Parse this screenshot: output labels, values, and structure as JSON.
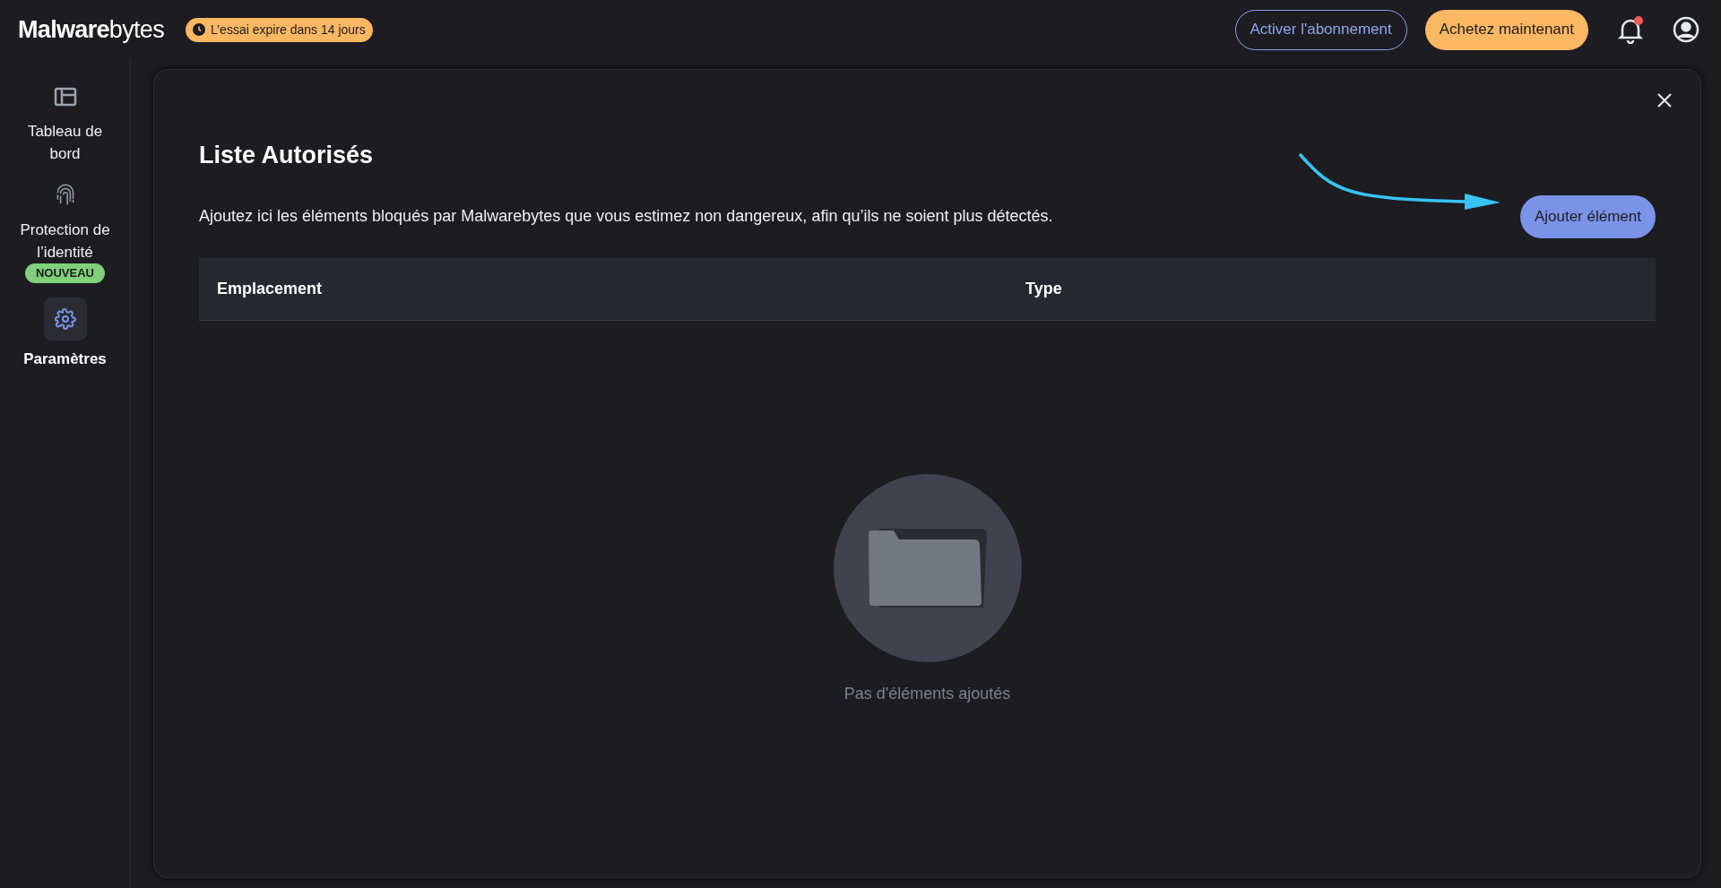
{
  "header": {
    "logo": "**Malware**bytes",
    "trial_badge": "L’essai expire dans 14 jours",
    "buttons": [
      {
        "label": "Activer l'abonnement",
        "kind": "outline"
      },
      {
        "label": "Achetez maintenant",
        "kind": "filled"
      }
    ],
    "notifications": {
      "unread": true
    }
  },
  "sidebar": {
    "items": [
      {
        "label": "Tableau de bord",
        "kind": "dashboard",
        "selected": false
      },
      {
        "label": "Protection de l’identité",
        "kind": "fingerprint",
        "selected": false,
        "badge": "NOUVEAU"
      },
      {
        "label": "Paramètres",
        "kind": "gear",
        "selected": true
      }
    ]
  },
  "panel": {
    "title": "Liste Autorisés",
    "description": "Ajoutez ici les éléments bloqués par Malwarebytes que vous estimez non dangereux, afin qu’ils ne soient plus détectés.",
    "add_button": "Ajouter élément",
    "table": {
      "columns": [
        "Emplacement",
        "Type"
      ]
    },
    "empty_state": "Pas d'éléments ajoutés"
  }
}
